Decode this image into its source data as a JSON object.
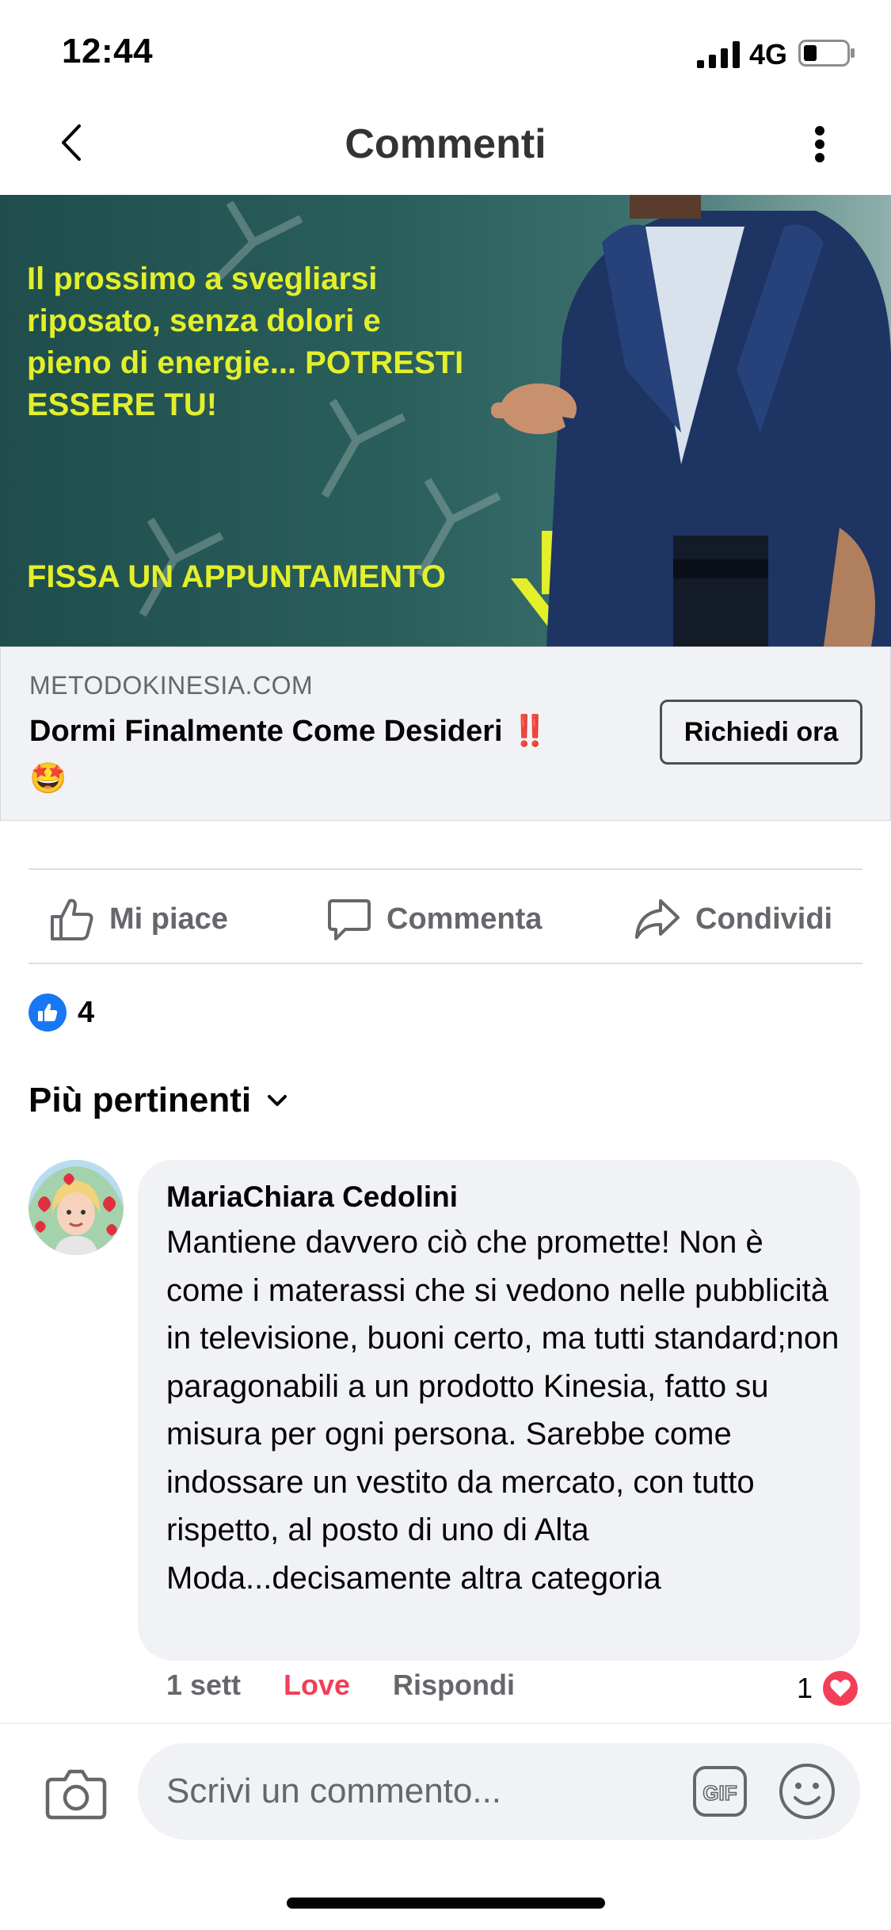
{
  "status_bar": {
    "time": "12:44",
    "network": "4G"
  },
  "header": {
    "title": "Commenti"
  },
  "ad": {
    "banner_text": "Il prossimo a svegliarsi riposato, senza dolori e pieno di energie... POTRESTI ESSERE TU!",
    "banner_cta": "FISSA UN APPUNTAMENTO",
    "domain": "METODOKINESIA.COM",
    "title": "Dormi Finalmente Come Desideri",
    "title_emoji": "‼️",
    "title_emoji_2": "🤩",
    "cta_label": "Richiedi ora"
  },
  "actions": {
    "like": "Mi piace",
    "comment": "Commenta",
    "share": "Condividi"
  },
  "reactions": {
    "count": "4"
  },
  "sort": {
    "label": "Più pertinenti"
  },
  "comment": {
    "author": "MariaChiara Cedolini",
    "text": "Mantiene davvero ciò che promette! Non è come i materassi che si vedono nelle pubblicità  in televisione, buoni certo, ma tutti standard;non paragonabili a un prodotto Kinesia, fatto  su misura per ogni persona. Sarebbe come indossare un vestito da mercato, con tutto rispetto, al posto di uno di Alta Moda...decisamente altra categoria",
    "time": "1 sett",
    "reaction_label": "Love",
    "reply_label": "Rispondi",
    "reaction_count": "1"
  },
  "composer": {
    "placeholder": "Scrivi un commento...",
    "gif_label": "GIF"
  },
  "colors": {
    "facebook_blue": "#1877f2",
    "love_red": "#f33e58",
    "banner_yellow": "#e3ef2a",
    "banner_teal": "#2a5f5c"
  }
}
